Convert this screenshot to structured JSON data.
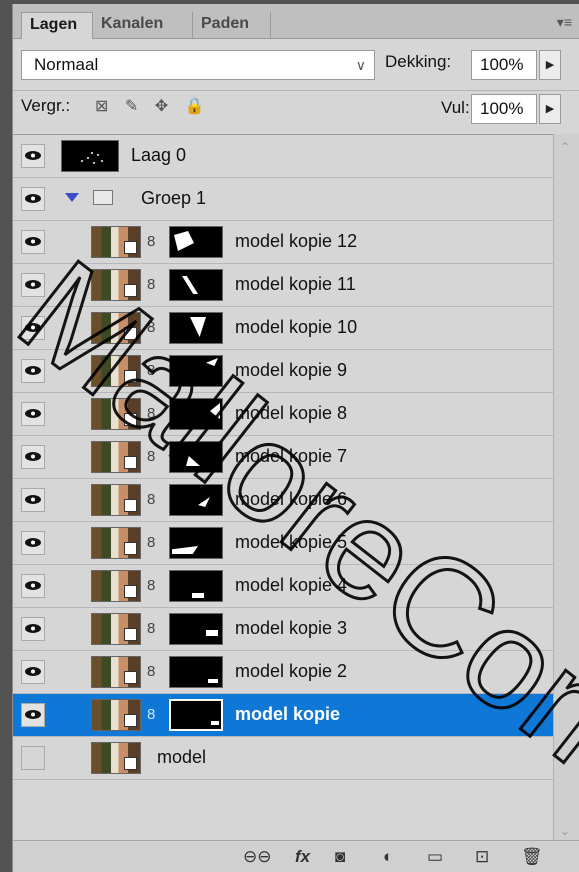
{
  "tabs": [
    {
      "label": "Lagen"
    },
    {
      "label": "Kanalen"
    },
    {
      "label": "Paden"
    }
  ],
  "panel_menu_icon": "panel-menu-icon",
  "blend_mode": {
    "value": "Normaal"
  },
  "opacity": {
    "label": "Dekking:",
    "value": "100%"
  },
  "lock": {
    "label": "Vergr.:"
  },
  "fill": {
    "label": "Vul:",
    "value": "100%"
  },
  "layers": [
    {
      "name": "Laag 0"
    },
    {
      "name": "Groep 1"
    },
    {
      "name": "model kopie 12"
    },
    {
      "name": "model kopie 11"
    },
    {
      "name": "model kopie 10"
    },
    {
      "name": "model kopie 9"
    },
    {
      "name": "model kopie 8"
    },
    {
      "name": "model kopie 7"
    },
    {
      "name": "model kopie 6"
    },
    {
      "name": "model kopie 5"
    },
    {
      "name": "model kopie 4"
    },
    {
      "name": "model kopie 3"
    },
    {
      "name": "model kopie 2"
    },
    {
      "name": "model kopie"
    },
    {
      "name": "model"
    }
  ],
  "selected_layer": "model kopie",
  "colors": {
    "selection": "#0f77d6",
    "group_arrow": "#3a4fc7",
    "watermark": "#000000"
  },
  "watermark_text": "MalloreCom"
}
